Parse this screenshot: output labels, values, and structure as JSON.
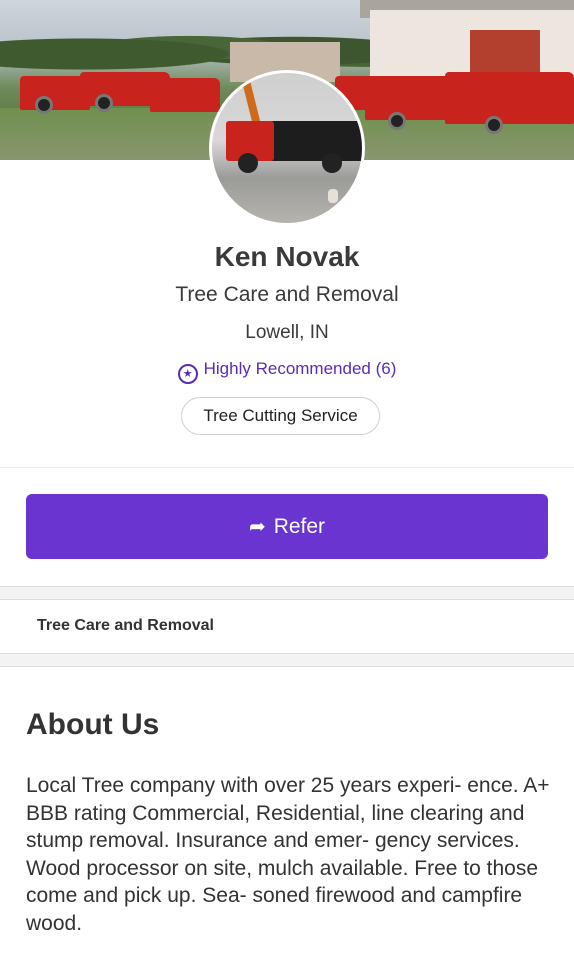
{
  "profile": {
    "name": "Ken Novak",
    "category": "Tree Care and Removal",
    "location": "Lowell, IN",
    "recommendation": "Highly Recommended (6)",
    "tag": "Tree Cutting Service"
  },
  "actions": {
    "refer_label": "Refer"
  },
  "section": {
    "tab_label": "Tree Care and Removal"
  },
  "about": {
    "title": "About Us",
    "text": "Local Tree company with over 25 years experi- ence. A+ BBB rating Commercial, Residential, line clearing and stump removal. Insurance and emer- gency services. Wood processor on site, mulch available. Free to those come and pick up. Sea- soned firewood and campfire wood."
  },
  "icons": {
    "recommend": "star-badge-icon",
    "refer": "share-arrow-icon"
  },
  "colors": {
    "accent": "#6a34d1",
    "accent_text": "#5a2bb8"
  }
}
